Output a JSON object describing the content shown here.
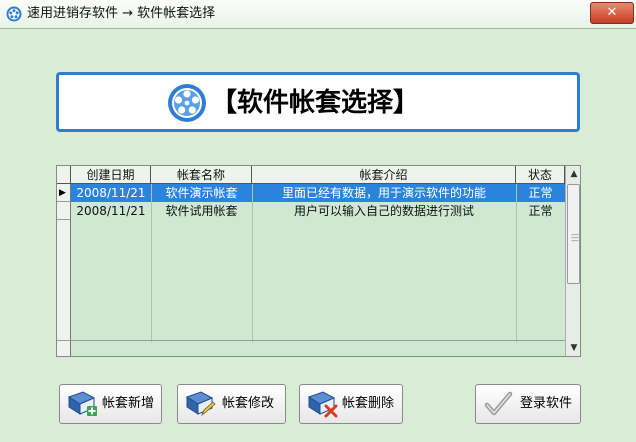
{
  "window": {
    "title": "速用进销存软件 → 软件帐套选择",
    "close_label": "✕"
  },
  "banner": {
    "title": "【软件帐套选择】"
  },
  "table": {
    "columns": [
      "创建日期",
      "帐套名称",
      "帐套介绍",
      "状态"
    ],
    "rows": [
      {
        "date": "2008/11/21",
        "name": "软件演示帐套",
        "desc": "里面已经有数据，用于演示软件的功能",
        "status": "正常"
      },
      {
        "date": "2008/11/21",
        "name": "软件试用帐套",
        "desc": "用户可以输入自己的数据进行测试",
        "status": "正常"
      }
    ],
    "selected_row": 0,
    "current_row_marker": "▶"
  },
  "buttons": {
    "add": "帐套新增",
    "edit": "帐套修改",
    "delete": "帐套删除",
    "login": "登录软件"
  },
  "colors": {
    "accent": "#2f7ed3",
    "selection": "#2a83dd",
    "background": "#d9ecd6"
  }
}
